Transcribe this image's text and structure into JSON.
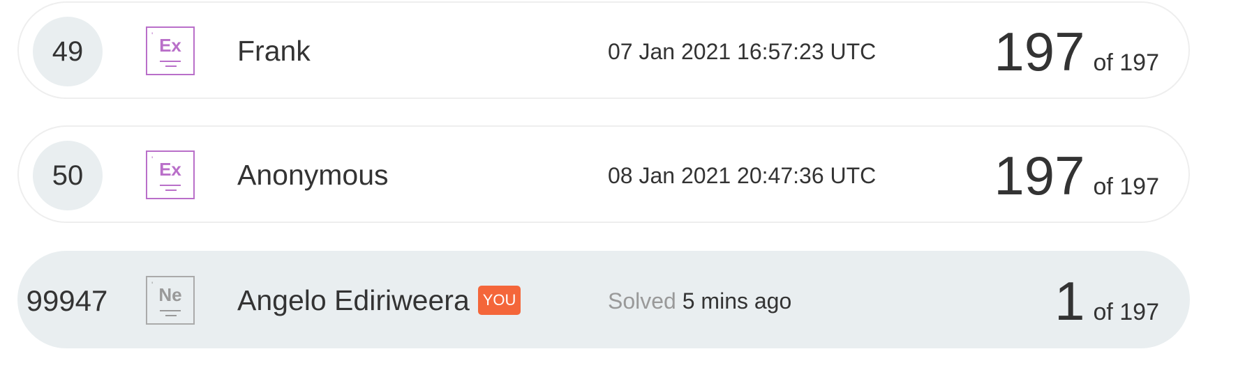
{
  "rows": [
    {
      "rank": "49",
      "badge": "Ex",
      "name": "Frank",
      "time": "07 Jan 2021 16:57:23 UTC",
      "solved": "197",
      "total": "of 197"
    },
    {
      "rank": "50",
      "badge": "Ex",
      "name": "Anonymous",
      "time": "08 Jan 2021 20:47:36 UTC",
      "solved": "197",
      "total": "of 197"
    },
    {
      "rank": "99947",
      "badge": "Ne",
      "name": "Angelo Ediriweera",
      "you": "YOU",
      "time_prefix": "Solved",
      "time": "5 mins ago",
      "solved": "1",
      "total": "of 197"
    }
  ],
  "colors": {
    "expert_badge": "#b96fc9",
    "newbie_badge": "#aaaaaa",
    "you_badge": "#f4663a",
    "current_row_bg": "#e9eef0"
  }
}
